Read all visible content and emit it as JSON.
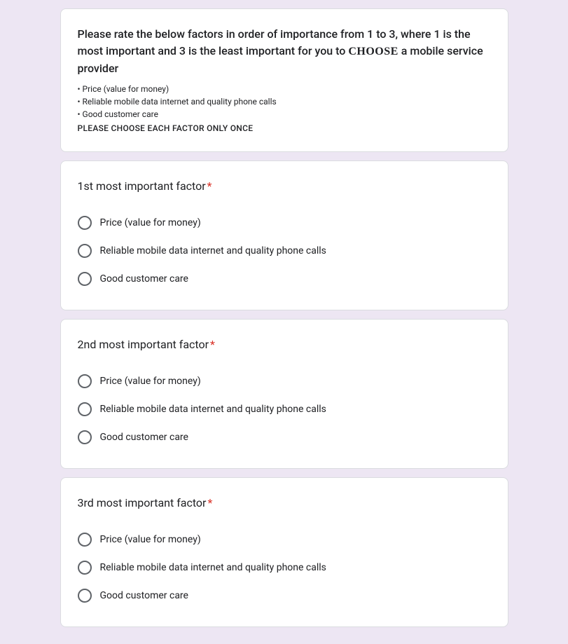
{
  "intro": {
    "title_pre": "Please rate the below factors in order of importance from 1 to 3, where 1 is the most important and 3 is the least important for you to ",
    "title_choose": "CHOOSE",
    "title_post": " a mobile service provider",
    "bullets": [
      "• Price (value for money)",
      "• Reliable mobile data internet and quality phone calls",
      "• Good customer care"
    ],
    "footer": "PLEASE CHOOSE EACH FACTOR ONLY ONCE"
  },
  "required_mark": "*",
  "questions": [
    {
      "title": "1st most important factor",
      "required": true,
      "options": [
        "Price (value for money)",
        "Reliable mobile data internet and quality phone calls",
        "Good customer care"
      ]
    },
    {
      "title": "2nd most important factor",
      "required": true,
      "options": [
        "Price (value for money)",
        "Reliable mobile data internet and quality phone calls",
        "Good customer care"
      ]
    },
    {
      "title": "3rd most important factor",
      "required": true,
      "options": [
        "Price (value for money)",
        "Reliable mobile data internet and quality phone calls",
        "Good customer care"
      ]
    }
  ]
}
